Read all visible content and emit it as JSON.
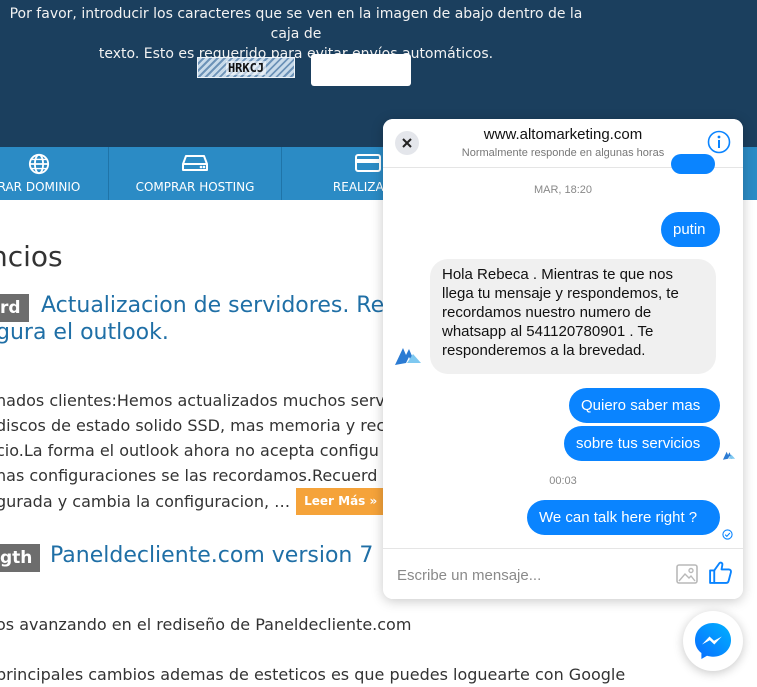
{
  "banner": {
    "message_line1": "Por favor, introducir los caracteres que se ven en la imagen de abajo dentro de la caja de",
    "message_line2": "texto. Esto es requerido para evitar envíos automáticos.",
    "captcha_text": "HRKCJ",
    "captcha_input_value": ""
  },
  "nav": {
    "items": [
      {
        "label": "RAR DOMINIO",
        "icon": "globe-icon"
      },
      {
        "label": "COMPRAR HOSTING",
        "icon": "server-icon"
      },
      {
        "label": "REALIZAR P",
        "icon": "card-icon"
      }
    ]
  },
  "content": {
    "page_title": "ncios",
    "posts": [
      {
        "tag": "rd",
        "title_line1": "Actualizacion de servidores. Re",
        "title_line2": "gura el outlook.",
        "lines": [
          "nados clientes:Hemos actualizados muchos serv",
          "discos de estado solido SSD, mas memoria y rec",
          "cio.La forma el outlook ahora no acepta configu",
          "nas configuraciones se las recordamos.Recuerd",
          "gurada y cambia la configuracion, …"
        ],
        "read_more": "Leer Más »"
      },
      {
        "tag": "gth",
        "title_line1": "Paneldecliente.com version 7",
        "lines": [
          "os avanzando en el rediseño de Paneldecliente.com",
          "principales cambios ademas de esteticos es que puedes loguearte con Google"
        ]
      }
    ]
  },
  "chat": {
    "site": "www.altomarketing.com",
    "status": "Normalmente responde en algunas horas",
    "timestamp1": "MAR, 18:20",
    "msg_putin": "putin",
    "msg_reply": "Hola Rebeca . Mientras te que nos llega tu mensaje y respondemos, te recordamos nuestro numero de whatsapp al 541120780901 . Te responderemos a la brevedad.",
    "msg_saber": "Quiero saber mas",
    "msg_servicios": "sobre tus servicios",
    "timestamp2": "00:03",
    "msg_talk": "We can talk here right ?",
    "input_placeholder": "Escribe un mensaje..."
  },
  "colors": {
    "banner_bg": "#1b3f5e",
    "nav_bg": "#2b8bc5",
    "messenger_blue": "#0a84ff",
    "link_blue": "#1f6fa6",
    "read_more_orange": "#f5a33a"
  }
}
